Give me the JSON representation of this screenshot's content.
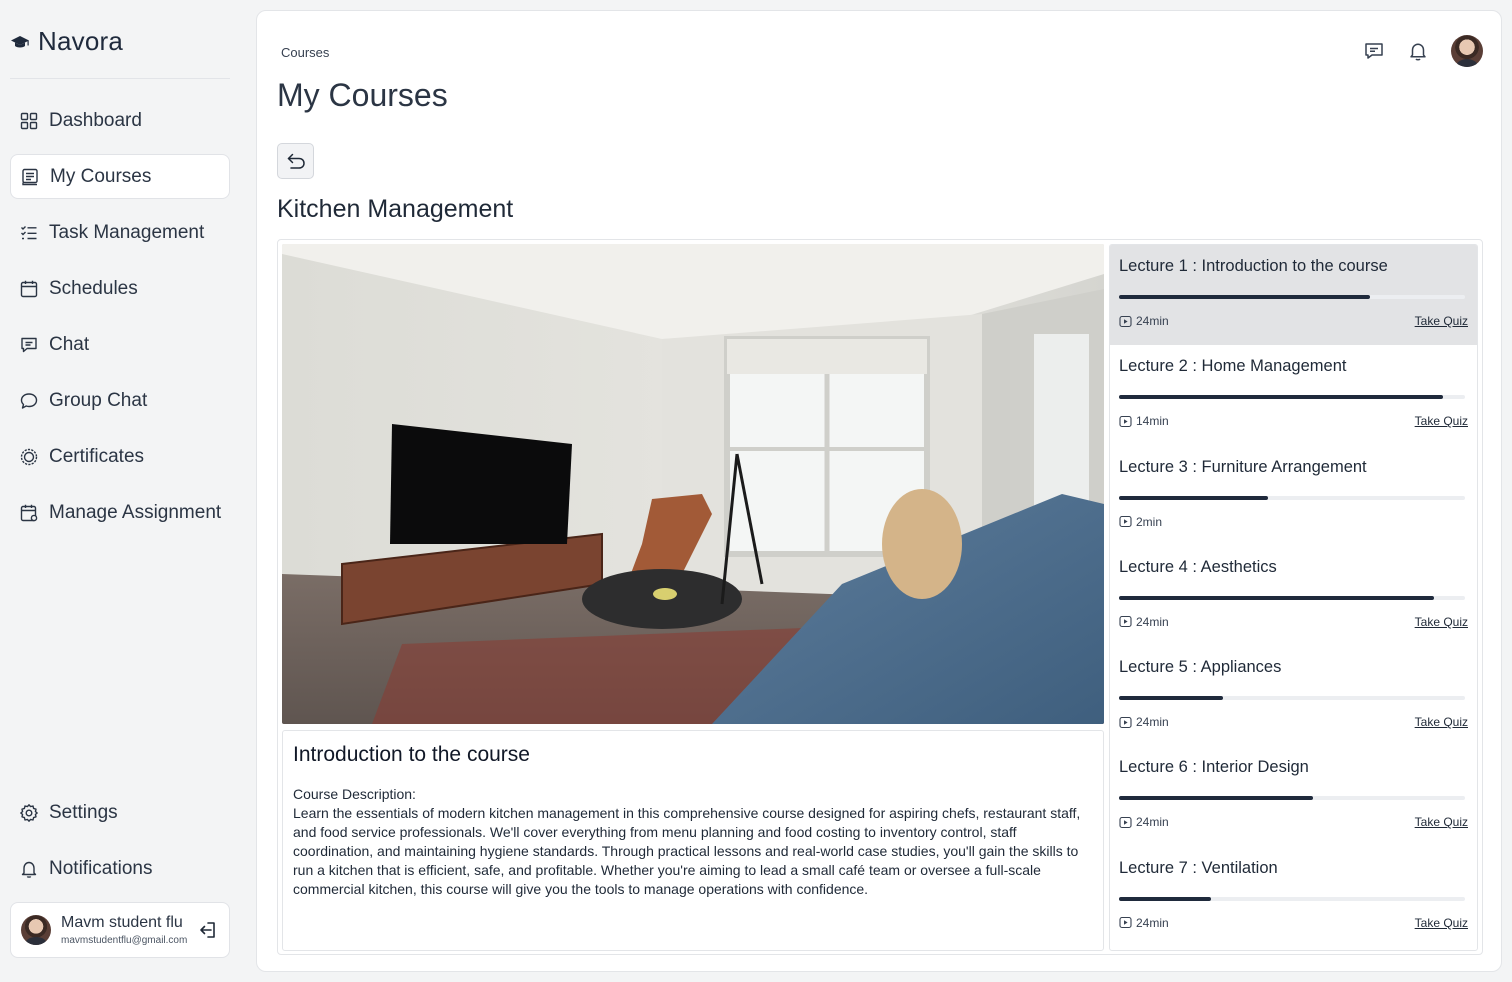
{
  "app": {
    "name": "Navora"
  },
  "sidebar": {
    "items": [
      {
        "label": "Dashboard",
        "icon": "grid-icon",
        "active": false
      },
      {
        "label": "My Courses",
        "icon": "book-icon",
        "active": true
      },
      {
        "label": "Task Management",
        "icon": "checklist-icon",
        "active": false
      },
      {
        "label": "Schedules",
        "icon": "calendar-icon",
        "active": false
      },
      {
        "label": "Chat",
        "icon": "chat-icon",
        "active": false
      },
      {
        "label": "Group Chat",
        "icon": "group-chat-icon",
        "active": false
      },
      {
        "label": "Certificates",
        "icon": "badge-icon",
        "active": false
      },
      {
        "label": "Manage Assignment",
        "icon": "calendar-edit-icon",
        "active": false
      }
    ],
    "bottom": [
      {
        "label": "Settings",
        "icon": "gear-icon"
      },
      {
        "label": "Notifications",
        "icon": "bell-icon"
      }
    ],
    "user": {
      "name": "Mavm student flu",
      "email": "mavmstudentflu@gmail.com"
    }
  },
  "header": {
    "breadcrumb": "Courses",
    "title": "My Courses"
  },
  "course": {
    "title": "Kitchen Management",
    "current": {
      "title": "Introduction to the course",
      "description_label": "Course Description:",
      "description": "Learn the essentials of modern kitchen management in this comprehensive course designed for aspiring chefs, restaurant staff, and food service professionals. We'll cover everything from menu planning and food costing to inventory control, staff coordination, and maintaining hygiene standards.  Through practical lessons and real-world case studies, you'll gain the skills to run a kitchen that is efficient, safe, and profitable. Whether you're aiming to lead a small café team or oversee a full-scale commercial kitchen, this course will give you the tools to manage operations with confidence."
    },
    "lectures": [
      {
        "title": "Lecture 1 : Introduction to the course",
        "duration": "24min",
        "progress": 0.725,
        "quiz": "Take Quiz",
        "active": true
      },
      {
        "title": "Lecture 2 : Home Management",
        "duration": "14min",
        "progress": 0.935,
        "quiz": "Take Quiz",
        "active": false
      },
      {
        "title": "Lecture 3 : Furniture Arrangement",
        "duration": "2min",
        "progress": 0.43,
        "quiz": "",
        "active": false
      },
      {
        "title": "Lecture 4 : Aesthetics",
        "duration": "24min",
        "progress": 0.91,
        "quiz": "Take Quiz",
        "active": false
      },
      {
        "title": "Lecture 5 : Appliances",
        "duration": "24min",
        "progress": 0.3,
        "quiz": "Take Quiz",
        "active": false
      },
      {
        "title": "Lecture 6 : Interior Design",
        "duration": "24min",
        "progress": 0.56,
        "quiz": "Take Quiz",
        "active": false
      },
      {
        "title": "Lecture 7 : Ventilation",
        "duration": "24min",
        "progress": 0.265,
        "quiz": "Take Quiz",
        "active": false
      }
    ]
  },
  "colors": {
    "accent": "#1f2a3c",
    "background": "#f3f4f5",
    "active_lecture": "#e2e3e5"
  }
}
